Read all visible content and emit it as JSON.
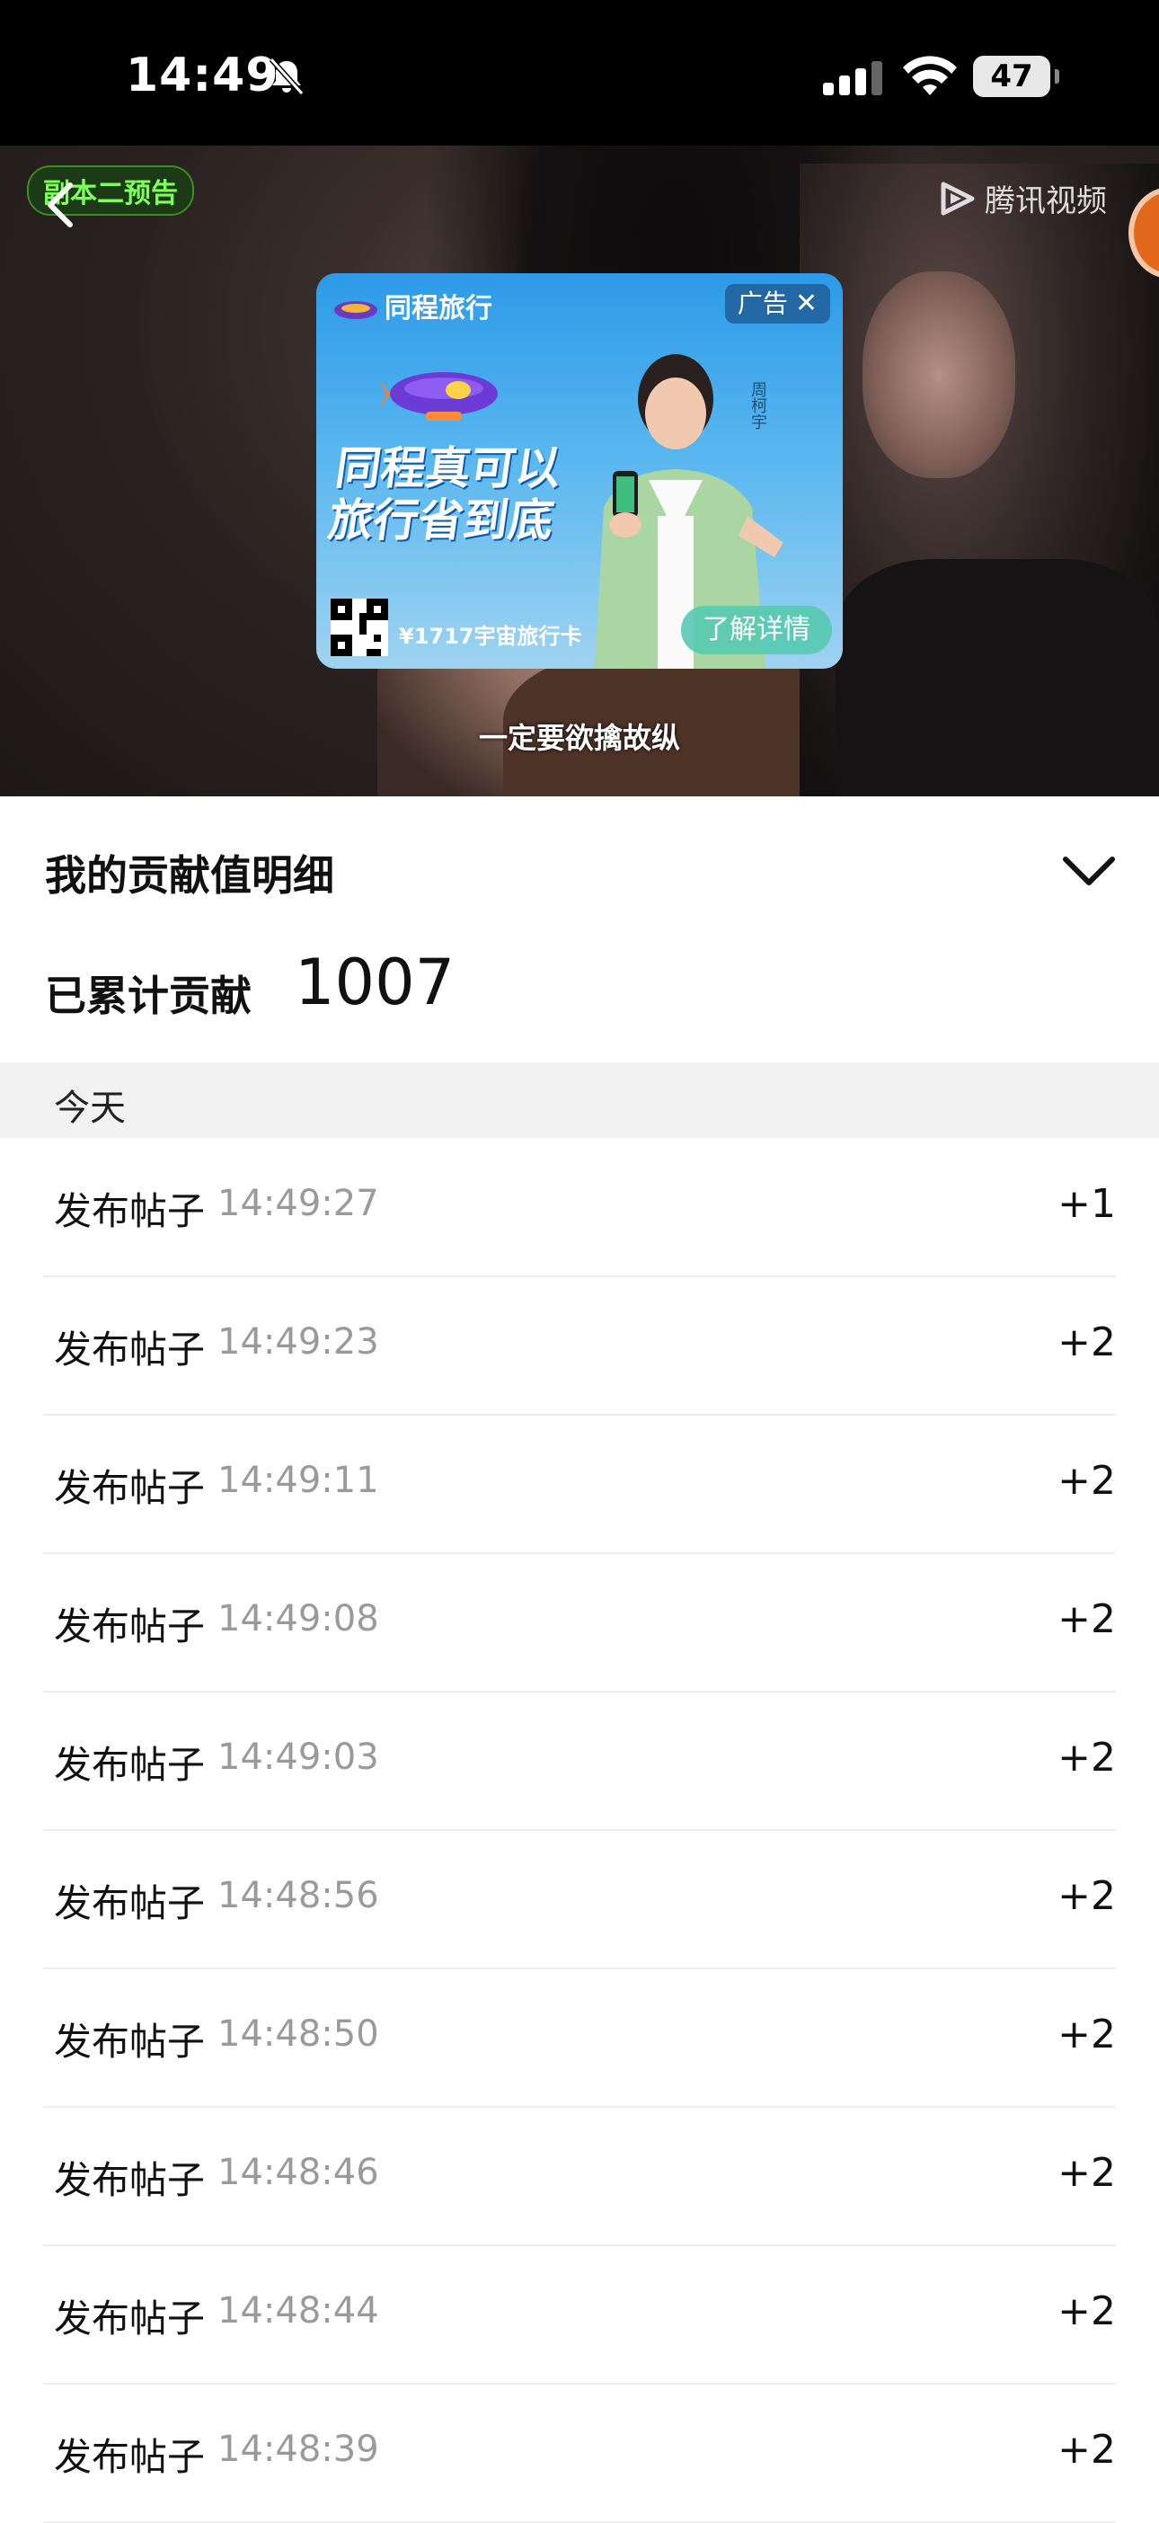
{
  "status_bar": {
    "time": "14:49",
    "battery": "47"
  },
  "video": {
    "episode_tag": "副本二预告",
    "logo_text": "腾讯视频",
    "subtitle": "一定要欲擒故纵"
  },
  "ad": {
    "brand": "同程旅行",
    "close_label": "广告",
    "close_symbol": "✕",
    "slogan_line1": "同程真可以",
    "slogan_line2": "旅行省到底",
    "spokesperson": "周柯宇",
    "price_text": "¥1717宇宙旅行卡",
    "cta": "了解详情"
  },
  "contribution": {
    "title": "我的贡献值明细",
    "total_label": "已累计贡献",
    "total_value": "1007",
    "day_label": "今天",
    "records": [
      {
        "action": "发布帖子",
        "time": "14:49:27",
        "points": "+1"
      },
      {
        "action": "发布帖子",
        "time": "14:49:23",
        "points": "+2"
      },
      {
        "action": "发布帖子",
        "time": "14:49:11",
        "points": "+2"
      },
      {
        "action": "发布帖子",
        "time": "14:49:08",
        "points": "+2"
      },
      {
        "action": "发布帖子",
        "time": "14:49:03",
        "points": "+2"
      },
      {
        "action": "发布帖子",
        "time": "14:48:56",
        "points": "+2"
      },
      {
        "action": "发布帖子",
        "time": "14:48:50",
        "points": "+2"
      },
      {
        "action": "发布帖子",
        "time": "14:48:46",
        "points": "+2"
      },
      {
        "action": "发布帖子",
        "time": "14:48:44",
        "points": "+2"
      },
      {
        "action": "发布帖子",
        "time": "14:48:39",
        "points": "+2"
      }
    ]
  }
}
